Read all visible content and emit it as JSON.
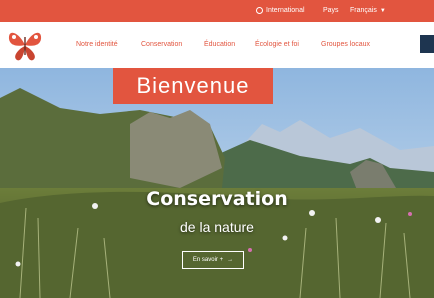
{
  "topbar": {
    "international": "International",
    "pays": "Pays",
    "language": "Français"
  },
  "nav": {
    "items": [
      "Notre identité",
      "Conservation",
      "Éducation",
      "Écologie et foi",
      "Groupes locaux"
    ]
  },
  "hero": {
    "banner": "Bienvenue",
    "headline": "Conservation",
    "subheadline": "de la nature",
    "cta": "En savoir +"
  },
  "colors": {
    "accent": "#e2553f",
    "nav_button": "#1e3550"
  }
}
